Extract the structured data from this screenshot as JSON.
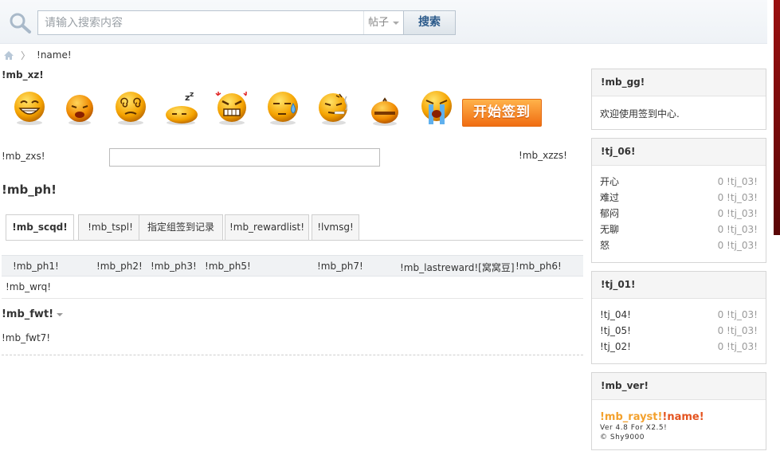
{
  "search": {
    "placeholder": "请输入搜索内容",
    "type_label": "帖子",
    "button_label": "搜索"
  },
  "breadcrumb": {
    "separator": "〉",
    "current": "!name!"
  },
  "sign": {
    "section_label": "!mb_xz!",
    "faces": [
      "laughing",
      "sad",
      "dizzy",
      "sleepy",
      "angry",
      "sweating",
      "smoking",
      "shy",
      "crying"
    ],
    "start_button": "开始签到",
    "zxs_label": "!mb_zxs!",
    "zxs_value": "",
    "xzzs_label": "!mb_xzzs!"
  },
  "ranking": {
    "title": "!mb_ph!",
    "tabs": [
      "!mb_scqd!",
      "!mb_tspl!",
      "指定组签到记录",
      "!mb_rewardlist!",
      "!lvmsg!"
    ],
    "active_tab": 0,
    "columns": [
      "!mb_ph1!",
      "!mb_ph2!",
      "!mb_ph3!",
      "!mb_ph5!",
      "!mb_ph7!",
      "!mb_lastreward![窝窝豆]",
      "!mb_ph6!"
    ],
    "empty_text": "!mb_wrq!"
  },
  "fwt": {
    "title": "!mb_fwt!",
    "text": "!mb_fwt7!"
  },
  "sidebar": {
    "announce": {
      "title": "!mb_gg!",
      "text": "欢迎使用签到中心."
    },
    "moods": {
      "title": "!tj_06!",
      "rows": [
        {
          "label": "开心",
          "value": "0 !tj_03!"
        },
        {
          "label": "难过",
          "value": "0 !tj_03!"
        },
        {
          "label": "郁闷",
          "value": "0 !tj_03!"
        },
        {
          "label": "无聊",
          "value": "0 !tj_03!"
        },
        {
          "label": "怒",
          "value": "0 !tj_03!"
        }
      ]
    },
    "stats": {
      "title": "!tj_01!",
      "rows": [
        {
          "label": "!tj_04!",
          "value": "0 !tj_03!"
        },
        {
          "label": "!tj_05!",
          "value": "0 !tj_03!"
        },
        {
          "label": "!tj_02!",
          "value": "0 !tj_03!"
        }
      ]
    },
    "version": {
      "title": "!mb_ver!",
      "brand_a": "!mb_rayst!",
      "brand_b": "!name!",
      "line1": "Ver 4.8 For X2.5!",
      "line2": "© Shy9000"
    }
  },
  "colors": {
    "accent_orange": "#f06d12",
    "search_button_text": "#2b5a8a",
    "brand_yellow": "#f3a12d",
    "brand_red": "#e4531f"
  }
}
